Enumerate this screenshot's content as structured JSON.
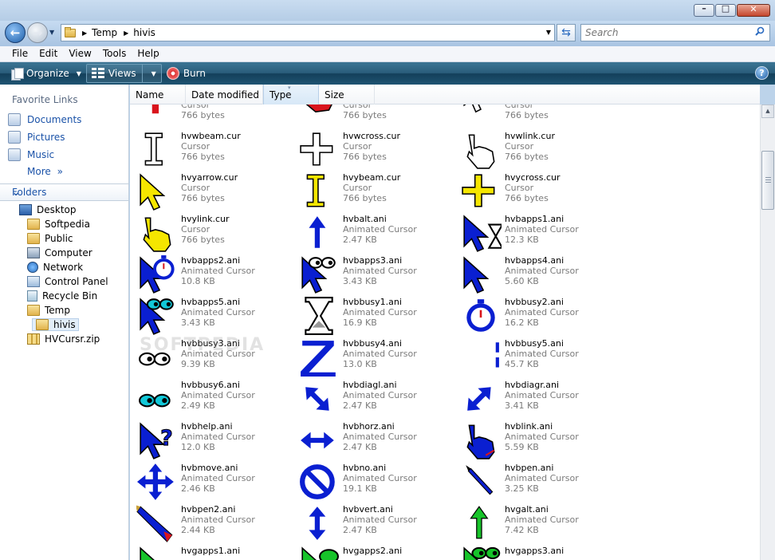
{
  "window": {
    "minimize_glyph": "–",
    "maximize_glyph": "□",
    "close_glyph": "✕"
  },
  "address": {
    "crumbs": [
      "Temp",
      "hivis"
    ],
    "search_placeholder": "Search"
  },
  "menu": [
    "File",
    "Edit",
    "View",
    "Tools",
    "Help"
  ],
  "commands": {
    "organize": "Organize",
    "views": "Views",
    "burn": "Burn",
    "help_glyph": "?"
  },
  "nav": {
    "favorites_title": "Favorite Links",
    "favorites": [
      "Documents",
      "Pictures",
      "Music"
    ],
    "more": "More",
    "more_glyph": "»",
    "folders_title": "Folders",
    "tree": [
      "Desktop",
      "Softpedia",
      "Public",
      "Computer",
      "Network",
      "Control Panel",
      "Recycle Bin",
      "Temp",
      "hivis",
      "HVCursr.zip"
    ]
  },
  "columns": [
    "Name",
    "Date modified",
    "Type",
    "Size"
  ],
  "watermark": "SOFTPEDIA",
  "colors": {
    "accent_blue": "#1a52a8",
    "cursor_blue": "#0a1fd1",
    "cursor_yellow": "#f5e600",
    "cursor_red": "#d9141c",
    "cursor_green": "#17c42a"
  },
  "files": [
    {
      "name": "",
      "type": "Cursor",
      "size": "766 bytes",
      "icon": "red-ibeam-icon"
    },
    {
      "name": "",
      "type": "Cursor",
      "size": "766 bytes",
      "icon": "red-hand-icon"
    },
    {
      "name": "",
      "type": "Cursor",
      "size": "766 bytes",
      "icon": "white-arrow-icon"
    },
    {
      "name": "hvwbeam.cur",
      "type": "Cursor",
      "size": "766 bytes",
      "icon": "white-ibeam-icon"
    },
    {
      "name": "hvwcross.cur",
      "type": "Cursor",
      "size": "766 bytes",
      "icon": "white-cross-icon"
    },
    {
      "name": "hvwlink.cur",
      "type": "Cursor",
      "size": "766 bytes",
      "icon": "white-hand-icon"
    },
    {
      "name": "hvyarrow.cur",
      "type": "Cursor",
      "size": "766 bytes",
      "icon": "yellow-arrow-icon"
    },
    {
      "name": "hvybeam.cur",
      "type": "Cursor",
      "size": "766 bytes",
      "icon": "yellow-ibeam-icon"
    },
    {
      "name": "hvycross.cur",
      "type": "Cursor",
      "size": "766 bytes",
      "icon": "yellow-cross-icon"
    },
    {
      "name": "hvylink.cur",
      "type": "Cursor",
      "size": "766 bytes",
      "icon": "yellow-hand-icon"
    },
    {
      "name": "hvbalt.ani",
      "type": "Animated Cursor",
      "size": "2.47 KB",
      "icon": "blue-up-arrow-icon"
    },
    {
      "name": "hvbapps1.ani",
      "type": "Animated Cursor",
      "size": "12.3 KB",
      "icon": "blue-arrow-hourglass-icon"
    },
    {
      "name": "hvbapps2.ani",
      "type": "Animated Cursor",
      "size": "10.8 KB",
      "icon": "blue-arrow-stopwatch-icon"
    },
    {
      "name": "hvbapps3.ani",
      "type": "Animated Cursor",
      "size": "3.43 KB",
      "icon": "blue-arrow-eyes-icon"
    },
    {
      "name": "hvbapps4.ani",
      "type": "Animated Cursor",
      "size": "5.60 KB",
      "icon": "blue-arrow-icon"
    },
    {
      "name": "hvbapps5.ani",
      "type": "Animated Cursor",
      "size": "3.43 KB",
      "icon": "blue-arrow-cyan-eyes-icon"
    },
    {
      "name": "hvbbusy1.ani",
      "type": "Animated Cursor",
      "size": "16.9 KB",
      "icon": "hourglass-icon"
    },
    {
      "name": "hvbbusy2.ani",
      "type": "Animated Cursor",
      "size": "16.2 KB",
      "icon": "stopwatch-icon"
    },
    {
      "name": "hvbbusy3.ani",
      "type": "Animated Cursor",
      "size": "9.39 KB",
      "icon": "eyes-icon"
    },
    {
      "name": "hvbbusy4.ani",
      "type": "Animated Cursor",
      "size": "13.0 KB",
      "icon": "z-sleep-icon"
    },
    {
      "name": "hvbbusy5.ani",
      "type": "Animated Cursor",
      "size": "45.7 KB",
      "icon": "blue-bar-icon"
    },
    {
      "name": "hvbbusy6.ani",
      "type": "Animated Cursor",
      "size": "2.49 KB",
      "icon": "cyan-eyes-icon"
    },
    {
      "name": "hvbdiagl.ani",
      "type": "Animated Cursor",
      "size": "2.47 KB",
      "icon": "diag-left-resize-icon"
    },
    {
      "name": "hvbdiagr.ani",
      "type": "Animated Cursor",
      "size": "3.41 KB",
      "icon": "diag-right-resize-icon"
    },
    {
      "name": "hvbhelp.ani",
      "type": "Animated Cursor",
      "size": "12.0 KB",
      "icon": "help-arrow-icon"
    },
    {
      "name": "hvbhorz.ani",
      "type": "Animated Cursor",
      "size": "2.47 KB",
      "icon": "horizontal-resize-icon"
    },
    {
      "name": "hvblink.ani",
      "type": "Animated Cursor",
      "size": "5.59 KB",
      "icon": "blue-hand-icon"
    },
    {
      "name": "hvbmove.ani",
      "type": "Animated Cursor",
      "size": "2.46 KB",
      "icon": "move-icon"
    },
    {
      "name": "hvbno.ani",
      "type": "Animated Cursor",
      "size": "19.1 KB",
      "icon": "no-entry-icon"
    },
    {
      "name": "hvbpen.ani",
      "type": "Animated Cursor",
      "size": "3.25 KB",
      "icon": "pen-icon"
    },
    {
      "name": "hvbpen2.ani",
      "type": "Animated Cursor",
      "size": "2.44 KB",
      "icon": "pencil-icon"
    },
    {
      "name": "hvbvert.ani",
      "type": "Animated Cursor",
      "size": "2.47 KB",
      "icon": "vertical-resize-icon"
    },
    {
      "name": "hvgalt.ani",
      "type": "Animated Cursor",
      "size": "7.42 KB",
      "icon": "green-up-arrow-icon"
    },
    {
      "name": "hvgapps1.ani",
      "type": "",
      "size": "",
      "icon": "green-arrow-icon"
    },
    {
      "name": "hvgapps2.ani",
      "type": "",
      "size": "",
      "icon": "green-arrow-busy-icon"
    },
    {
      "name": "hvgapps3.ani",
      "type": "",
      "size": "",
      "icon": "green-arrow-eyes-icon"
    }
  ]
}
